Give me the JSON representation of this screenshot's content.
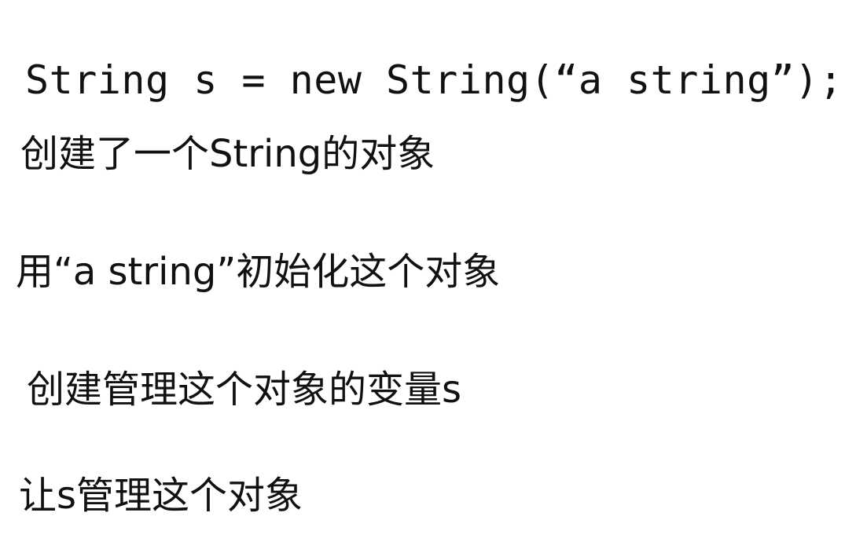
{
  "code": {
    "line": "String s = new String(“a string”);"
  },
  "notes": [
    {
      "text": "创建了一个String的对象"
    },
    {
      "text": "用“a string”初始化这个对象"
    },
    {
      "text": "创建管理这个对象的变量s"
    },
    {
      "text": "让s管理这个对象"
    }
  ]
}
